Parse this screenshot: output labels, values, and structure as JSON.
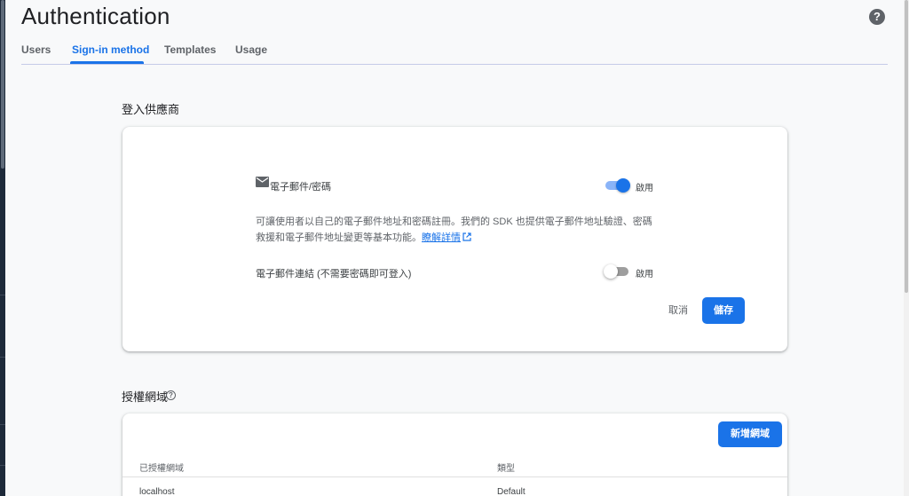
{
  "page": {
    "title": "Authentication"
  },
  "tabs": [
    {
      "label": "Users"
    },
    {
      "label": "Sign-in method"
    },
    {
      "label": "Templates"
    },
    {
      "label": "Usage"
    }
  ],
  "providers_section": {
    "title": "登入供應商",
    "provider": {
      "icon": "mail-icon",
      "label": "電子郵件/密碼",
      "enabled": true,
      "toggle_label": "啟用",
      "description": "可讓使用者以自己的電子郵件地址和密碼註冊。我們的 SDK 也提供電子郵件地址驗證、密碼救援和電子郵件地址變更等基本功能。",
      "learn_more": "瞭解詳情",
      "passwordless_label": "電子郵件連結 (不需要密碼即可登入)",
      "passwordless_enabled": false,
      "passwordless_toggle_label": "啟用"
    },
    "cancel_label": "取消",
    "save_label": "儲存"
  },
  "domains_section": {
    "title": "授權網域",
    "add_button_label": "新增網域",
    "columns": [
      "已授權網域",
      "類型"
    ],
    "rows": [
      {
        "domain": "localhost",
        "type": "Default"
      }
    ]
  },
  "colors": {
    "accent": "#1a73e8",
    "background": "#f8f9fa"
  }
}
